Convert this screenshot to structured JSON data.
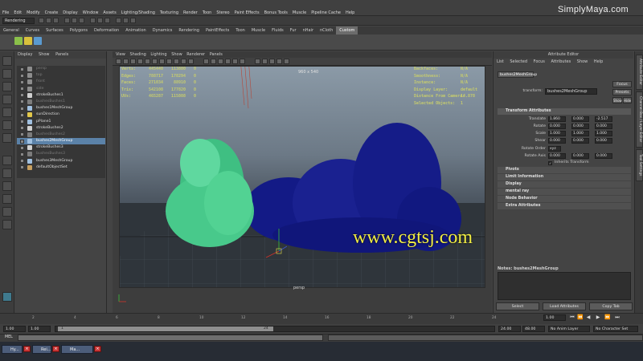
{
  "menubar": {
    "items": [
      "File",
      "Edit",
      "Modify",
      "Create",
      "Display",
      "Window",
      "Assets",
      "Lighting/Shading",
      "Texturing",
      "Render",
      "Toon",
      "Stereo",
      "Paint Effects",
      "Bonus Tools",
      "Muscle",
      "Pipeline Cache",
      "Help"
    ],
    "brand": "SimplyMaya.com"
  },
  "status": {
    "mode": "Rendering"
  },
  "shelf": {
    "tabs": [
      "General",
      "Curves",
      "Surfaces",
      "Polygons",
      "Deformation",
      "Animation",
      "Dynamics",
      "Rendering",
      "PaintEffects",
      "Toon",
      "Muscle",
      "Fluids",
      "Fur",
      "nHair",
      "nCloth",
      "Custom"
    ],
    "active_tab": "Custom"
  },
  "outliner": {
    "menu": [
      "Display",
      "Show",
      "Panels"
    ],
    "items": [
      {
        "label": "persp",
        "dim": true
      },
      {
        "label": "top",
        "dim": true
      },
      {
        "label": "front",
        "dim": true
      },
      {
        "label": "side",
        "dim": true
      },
      {
        "label": "strokeBushes1",
        "dim": false
      },
      {
        "label": "bushesBushes1",
        "dim": true
      },
      {
        "label": "bushes1MeshGroup",
        "dim": false
      },
      {
        "label": "sunDirection",
        "dim": false
      },
      {
        "label": "pPlane1",
        "dim": false
      },
      {
        "label": "strokeBushes2",
        "dim": false
      },
      {
        "label": "bushesBushes2",
        "dim": true
      },
      {
        "label": "bushes2MeshGroup",
        "dim": false,
        "selected": true
      },
      {
        "label": "strokeBushes3",
        "dim": false
      },
      {
        "label": "bushesBushes3",
        "dim": true
      },
      {
        "label": "bushes3MeshGroup",
        "dim": false
      },
      {
        "label": "defaultObjectSet",
        "dim": false
      }
    ]
  },
  "viewport": {
    "menu": [
      "View",
      "Shading",
      "Lighting",
      "Show",
      "Renderer",
      "Panels"
    ],
    "hud_left": {
      "labels": [
        "Verts:",
        "Edges:",
        "Faces:",
        "Tris:",
        "UVs:"
      ],
      "col1": [
        "445440",
        "788717",
        "271034",
        "542108",
        "465287"
      ],
      "col2": [
        "113880",
        "178294",
        "88910",
        "177820",
        "115808"
      ],
      "col3": [
        "0",
        "0",
        "0",
        "0",
        "0"
      ]
    },
    "hud_right": {
      "labels": [
        "Backfaces:",
        "Smoothness:",
        "Instance:",
        "Display Layer:",
        "Distance From Camera:",
        "Selected Objects:"
      ],
      "values": [
        "N/A",
        "N/A",
        "N/A",
        "default",
        "14.878",
        "1"
      ]
    },
    "resolution": "960 x 540",
    "camera_label": "persp",
    "watermark": "www.cgtsj.com"
  },
  "attribute_editor": {
    "title": "Attribute Editor",
    "menu": [
      "List",
      "Selected",
      "Focus",
      "Attributes",
      "Show",
      "Help"
    ],
    "node_tab": "bushes2MeshGroup",
    "transform_label": "transform:",
    "transform_value": "bushes2MeshGroup",
    "focus_btn": "Focus",
    "presets_btn": "Presets",
    "show_btn": "Show",
    "hide_btn": "Hide",
    "section_open": "Transform Attributes",
    "rows": [
      {
        "label": "Translate",
        "values": [
          "1.860",
          "0.000",
          "-2.517"
        ]
      },
      {
        "label": "Rotate",
        "values": [
          "0.000",
          "0.000",
          "0.000"
        ]
      },
      {
        "label": "Scale",
        "values": [
          "1.000",
          "1.000",
          "1.000"
        ]
      },
      {
        "label": "Shear",
        "values": [
          "0.000",
          "0.000",
          "0.000"
        ]
      }
    ],
    "rotate_order_label": "Rotate Order",
    "rotate_order_value": "xyz",
    "rotate_axis_label": "Rotate Axis",
    "rotate_axis_values": [
      "0.000",
      "0.000",
      "0.000"
    ],
    "inherits_label": "Inherits Transform",
    "sections": [
      "Pivots",
      "Limit Information",
      "Display",
      "mental ray",
      "Node Behavior",
      "Extra Attributes"
    ],
    "notes_label": "Notes:  bushes2MeshGroup",
    "select_btn": "Select",
    "load_btn": "Load Attributes",
    "copy_btn": "Copy Tab"
  },
  "right_tabs": [
    "Attribute Editor",
    "Channel Box / Layer Editor",
    "Tool Settings"
  ],
  "timeline": {
    "ticks": [
      "2",
      "4",
      "6",
      "8",
      "10",
      "12",
      "14",
      "16",
      "18",
      "20",
      "22",
      "24"
    ],
    "current": "1.00"
  },
  "range": {
    "start": "1.00",
    "inner_start": "1.00",
    "thumb_start": "1",
    "thumb_end": "24",
    "inner_end": "24.00",
    "end": "48.00",
    "anim_layer": "No Anim Layer",
    "char_set": "No Character Set"
  },
  "cmd": {
    "label": "MEL"
  },
  "taskbar": {
    "items": [
      "Hy...",
      "Rei...",
      "Ma..."
    ]
  }
}
